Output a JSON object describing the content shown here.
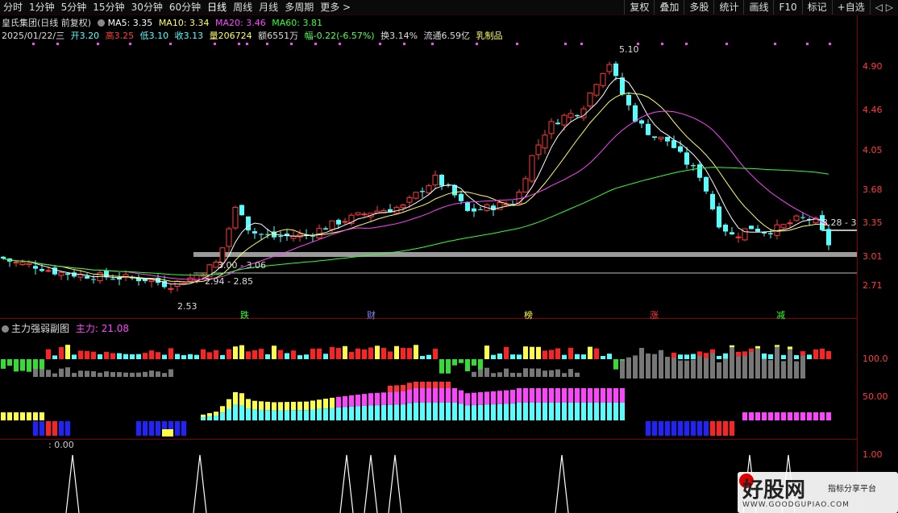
{
  "toolbar": {
    "periods": [
      "分时",
      "1分钟",
      "5分钟",
      "15分钟",
      "30分钟",
      "60分钟",
      "日线",
      "周线",
      "月线",
      "多周期",
      "更多 >"
    ],
    "right_buttons": [
      "复权",
      "叠加",
      "多股",
      "统计",
      "画线",
      "F10",
      "标记",
      "+自选",
      "◁ ▷"
    ]
  },
  "header": {
    "title": "皇氏集团(日线 前复权)",
    "ma5": "MA5: 3.35",
    "ma10": "MA10: 3.34",
    "ma20": "MA20: 3.46",
    "ma60": "MA60: 3.81",
    "date": "2025/01/22/三",
    "open": "开3.20",
    "high": "高3.25",
    "low": "低3.10",
    "close": "收3.13",
    "volume": "量206724",
    "amount": "额6551万",
    "change": "幅-0.22(-6.57%)",
    "turnover": "换3.14%",
    "float_value": "流通6.59亿",
    "sector": "乳制品"
  },
  "price_axis": [
    "4.90",
    "4.46",
    "4.05",
    "3.68",
    "3.35",
    "3.01",
    "2.71"
  ],
  "annotations": {
    "high_label": "5.10",
    "low_label": "2.53",
    "band1": "3.00 - 3.06",
    "band2": "2.94 - 2.85",
    "band3": "3.28 - 3"
  },
  "events": [
    "跌",
    "财",
    "榜",
    "涨",
    "减"
  ],
  "sub_indicator": {
    "title": "主力强弱副图",
    "value": "主力: 21.08",
    "axis": [
      "100.0",
      "50.00"
    ]
  },
  "sub3": {
    "value": ": 0.00",
    "axis": [
      "1.00"
    ]
  },
  "watermark": {
    "name": "好股网",
    "tagline": "指标分享平台",
    "url": "WWW.GOODGUPIAO.COM"
  },
  "colors": {
    "up": "#ff3b3b",
    "down": "#54ffff",
    "ma5": "#ffffff",
    "ma10": "#ffff66",
    "ma20": "#ff44ff",
    "ma60": "#33ff33"
  }
}
